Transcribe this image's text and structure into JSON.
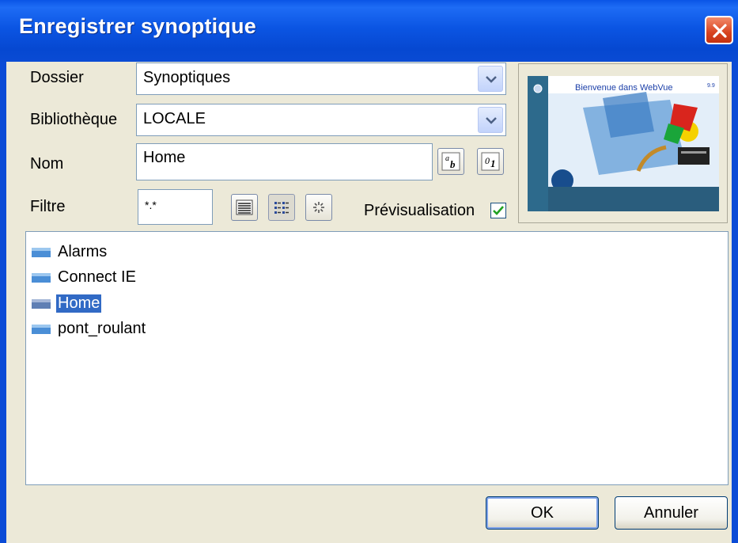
{
  "window": {
    "title": "Enregistrer synoptique"
  },
  "form": {
    "dossier_label": "Dossier",
    "dossier_value": "Synoptiques",
    "bibliotheque_label": "Bibliothèque",
    "bibliotheque_value": "LOCALE",
    "nom_label": "Nom",
    "nom_value": "Home",
    "filtre_label": "Filtre",
    "filtre_value": "*.*",
    "preview_label": "Prévisualisation",
    "preview_checked": true
  },
  "preview": {
    "heading": "Bienvenue dans WebVue",
    "version": "9.9"
  },
  "list": {
    "items": [
      {
        "label": "Alarms"
      },
      {
        "label": "Connect IE"
      },
      {
        "label": "Home",
        "selected": true
      },
      {
        "label": "pont_roulant"
      }
    ]
  },
  "buttons": {
    "ok": "OK",
    "cancel": "Annuler"
  },
  "colors": {
    "titlebar": "#0a55e6",
    "selection": "#316ac5",
    "dialog_bg": "#ece9d8"
  }
}
